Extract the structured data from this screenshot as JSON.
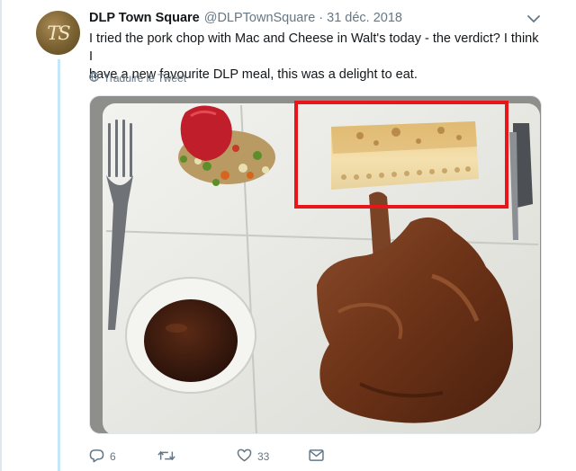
{
  "tweet": {
    "author_name": "DLP Town Square",
    "handle": "@DLPTownSquare",
    "separator": "·",
    "date": "31 déc. 2018",
    "avatar_text": "TS",
    "text_line1": "I tried the pork chop with Mac and Cheese in Walt's today - the verdict? I think I",
    "text_line2": "have a new favourite DLP meal, this was a delight to eat.",
    "translate_label": "Traduire le Tweet"
  },
  "actions": {
    "reply_count": "6",
    "retweet_count": "",
    "like_count": "33"
  },
  "colors": {
    "text": "#14171a",
    "muted": "#657786",
    "thread_line": "#c4e8f9",
    "highlight": "#e8161b"
  },
  "icons": [
    "globe-icon",
    "chevron-down-icon",
    "reply-icon",
    "retweet-icon",
    "heart-icon",
    "mail-icon"
  ]
}
